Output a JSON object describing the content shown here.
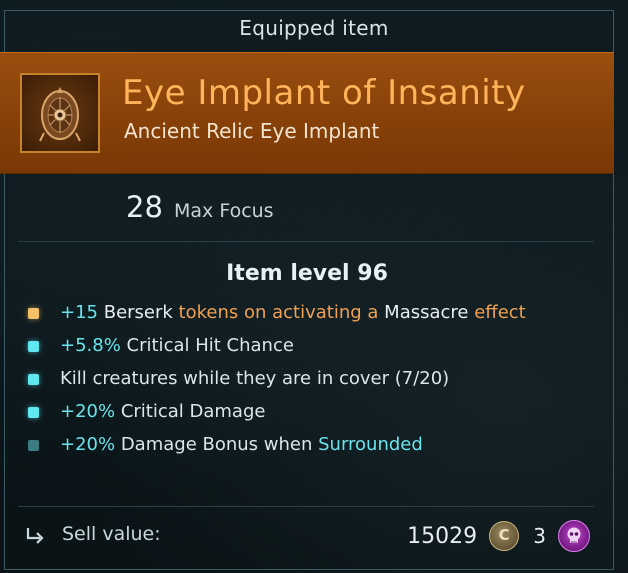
{
  "header": {
    "title": "Equipped item"
  },
  "item": {
    "name": "Eye Implant of Insanity",
    "type": "Ancient Relic Eye Implant",
    "icon": "eye-implant-icon",
    "rarity_color": "#ffb45c",
    "banner_color": "#8a4309"
  },
  "stat": {
    "value": "28",
    "label": "Max Focus"
  },
  "item_level": "Item level 96",
  "mods": [
    {
      "bullet": "gold",
      "parts": [
        {
          "text": "+15 ",
          "style": "teal"
        },
        {
          "text": "Berserk",
          "style": "white"
        },
        {
          "text": " tokens on activating a ",
          "style": "orange"
        },
        {
          "text": "Massacre",
          "style": "white"
        },
        {
          "text": " effect",
          "style": "orange"
        }
      ]
    },
    {
      "bullet": "teal",
      "parts": [
        {
          "text": "+5.8%",
          "style": "teal"
        },
        {
          "text": " Critical Hit Chance",
          "style": "plain"
        }
      ]
    },
    {
      "bullet": "teal",
      "parts": [
        {
          "text": "Kill creatures while they are in cover (7/20)",
          "style": "plain"
        }
      ]
    },
    {
      "bullet": "teal",
      "parts": [
        {
          "text": "+20%",
          "style": "teal"
        },
        {
          "text": " Critical Damage",
          "style": "plain"
        }
      ]
    },
    {
      "bullet": "dim",
      "parts": [
        {
          "text": "+20%",
          "style": "teal"
        },
        {
          "text": " Damage Bonus when ",
          "style": "plain"
        },
        {
          "text": "Surrounded",
          "style": "teal"
        }
      ]
    }
  ],
  "sell": {
    "label": "Sell value:",
    "amount": "15029",
    "currency_icon": "credits-coin-icon",
    "coin_glyph": "C",
    "secondary_count": "3",
    "secondary_icon": "skull-token-icon"
  }
}
